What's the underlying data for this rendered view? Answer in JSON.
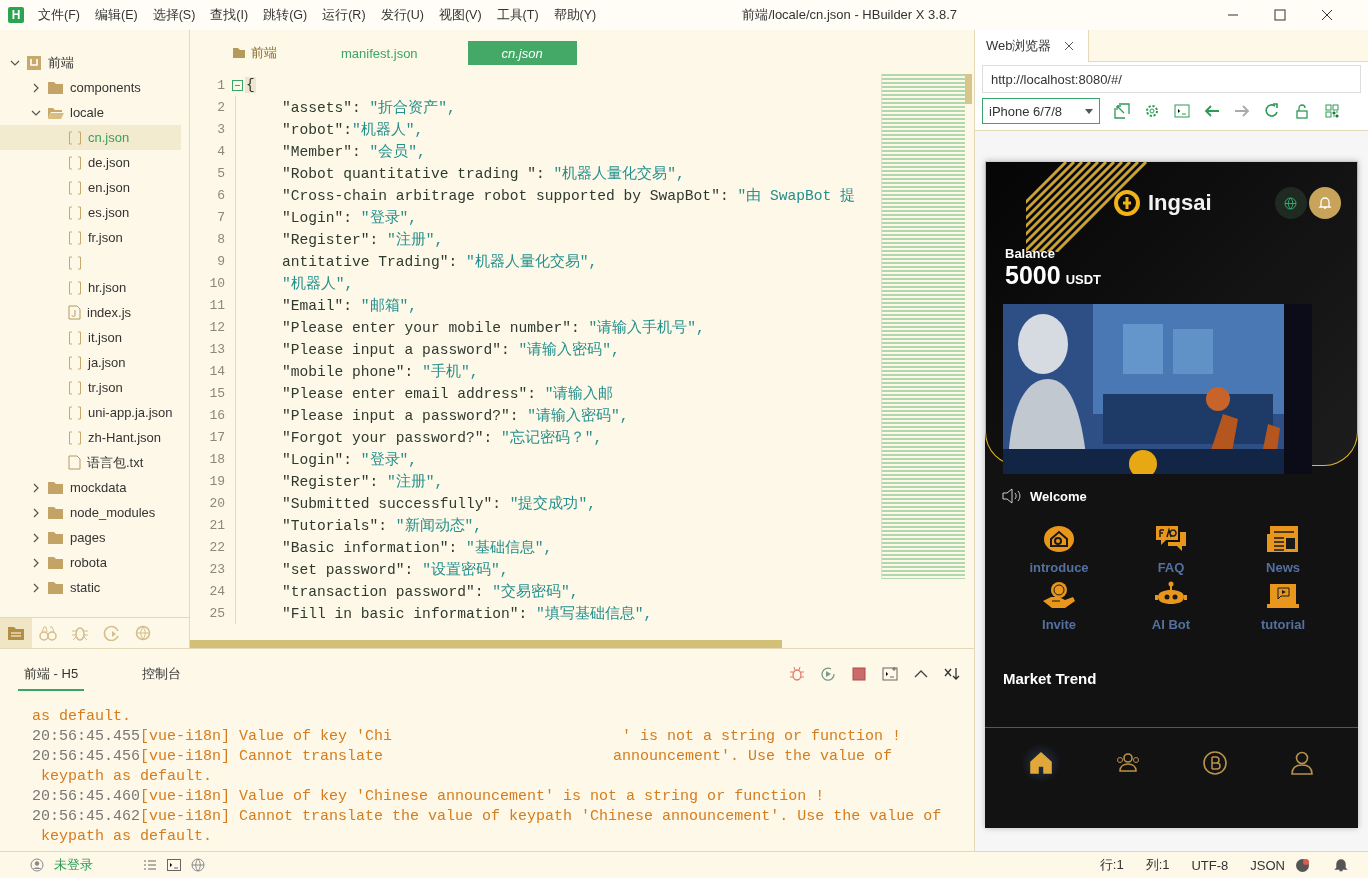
{
  "app_logo": "H",
  "menu": [
    "文件(F)",
    "编辑(E)",
    "选择(S)",
    "查找(I)",
    "跳转(G)",
    "运行(R)",
    "发行(U)",
    "视图(V)",
    "工具(T)",
    "帮助(Y)"
  ],
  "window": {
    "title": "前端/locale/cn.json - HBuilder X 3.8.7"
  },
  "tree": [
    {
      "name": "前端",
      "kind": "project",
      "expanded": true,
      "selected": false,
      "children": [
        {
          "name": "components",
          "kind": "folder",
          "expanded": false,
          "selected": false
        },
        {
          "name": "locale",
          "kind": "folder",
          "expanded": true,
          "selected": false,
          "children": [
            {
              "name": "cn.json",
              "kind": "json",
              "selected": true
            },
            {
              "name": "de.json",
              "kind": "json",
              "selected": false
            },
            {
              "name": "en.json",
              "kind": "json",
              "selected": false
            },
            {
              "name": "es.json",
              "kind": "json",
              "selected": false
            },
            {
              "name": "fr.json",
              "kind": "json",
              "selected": false
            },
            {
              "kind": "obscured",
              "selected": false
            },
            {
              "name": "hr.json",
              "kind": "json",
              "selected": false
            },
            {
              "name": "index.js",
              "kind": "js",
              "selected": false
            },
            {
              "name": "it.json",
              "kind": "json",
              "selected": false
            },
            {
              "name": "ja.json",
              "kind": "json",
              "selected": false
            },
            {
              "name": "tr.json",
              "kind": "json",
              "selected": false
            },
            {
              "name": "uni-app.ja.json",
              "kind": "json",
              "selected": false
            },
            {
              "name": "zh-Hant.json",
              "kind": "json",
              "selected": false
            },
            {
              "name": "语言包.txt",
              "kind": "txt",
              "selected": false
            }
          ]
        },
        {
          "name": "mockdata",
          "kind": "folder",
          "expanded": false,
          "selected": false
        },
        {
          "name": "node_modules",
          "kind": "folder",
          "expanded": false,
          "selected": false
        },
        {
          "name": "pages",
          "kind": "folder",
          "expanded": false,
          "selected": false
        },
        {
          "name": "robota",
          "kind": "folder",
          "expanded": false,
          "selected": false
        },
        {
          "name": "static",
          "kind": "folder",
          "expanded": false,
          "selected": false
        }
      ]
    }
  ],
  "sidebar_tools": [
    {
      "kind": "files",
      "selected": true
    },
    {
      "kind": "binoculars",
      "selected": false
    },
    {
      "kind": "bug",
      "selected": false
    },
    {
      "kind": "run",
      "selected": false
    },
    {
      "kind": "globe",
      "selected": false
    }
  ],
  "editor_tabs": [
    {
      "label": "前端",
      "kind": "project",
      "selected": false
    },
    {
      "label": "manifest.json",
      "kind": "file",
      "selected": false
    },
    {
      "label": "cn.json",
      "kind": "file",
      "selected": true
    }
  ],
  "code": {
    "open_line": "1",
    "open": "{",
    "entries": [
      {
        "n": "2",
        "k": "\"assets\": ",
        "v": "\"折合资产\","
      },
      {
        "n": "3",
        "k": "\"robot\":",
        "v": "\"机器人\","
      },
      {
        "n": "4",
        "k": "\"Member\": ",
        "v": "\"会员\","
      },
      {
        "n": "5",
        "k": "\"Robot quantitative trading \": ",
        "v": "\"机器人量化交易\","
      },
      {
        "n": "6",
        "k": "\"Cross-chain arbitrage robot supported by SwapBot\": ",
        "v": "\"由 SwapBot 提"
      },
      {
        "n": "7",
        "k": "\"Login\": ",
        "v": "\"登录\","
      },
      {
        "n": "8",
        "k": "\"Register\": ",
        "v": "\"注册\","
      },
      {
        "n": "9",
        "k": "antitative Trading\": ",
        "v": "\"机器人量化交易\","
      },
      {
        "n": "10",
        "v": "\"机器人\","
      },
      {
        "n": "11",
        "k": "\"Email\": ",
        "v": "\"邮箱\","
      },
      {
        "n": "12",
        "k": "\"Please enter your mobile number\": ",
        "v": "\"请输入手机号\","
      },
      {
        "n": "13",
        "k": "\"Please input a password\": ",
        "v": "\"请输入密码\","
      },
      {
        "n": "14",
        "k": "\"mobile phone\": ",
        "v": "\"手机\","
      },
      {
        "n": "15",
        "k": "\"Please enter email address\": ",
        "v": "\"请输入邮"
      },
      {
        "n": "16",
        "k": "\"Please input a password?\": ",
        "v": "\"请输入密码\","
      },
      {
        "n": "17",
        "k": "\"Forgot your password?\": ",
        "v": "\"忘记密码？\","
      },
      {
        "n": "18",
        "k": "\"Login\": ",
        "v": "\"登录\","
      },
      {
        "n": "19",
        "k": "\"Register\": ",
        "v": "\"注册\","
      },
      {
        "n": "20",
        "k": "\"Submitted successfully\": ",
        "v": "\"提交成功\","
      },
      {
        "n": "21",
        "k": "\"Tutorials\": ",
        "v": "\"新闻动态\","
      },
      {
        "n": "22",
        "k": "\"Basic information\": ",
        "v": "\"基础信息\","
      },
      {
        "n": "23",
        "k": "\"set password\": ",
        "v": "\"设置密码\","
      },
      {
        "n": "24",
        "k": "\"transaction password\": ",
        "v": "\"交易密码\","
      },
      {
        "n": "25",
        "k": "\"Fill in basic information\": ",
        "v": "\"填写基础信息\","
      }
    ]
  },
  "console": {
    "tabs": [
      {
        "label": "前端 - H5",
        "selected": true
      },
      {
        "label": "控制台",
        "selected": false
      }
    ],
    "tools": [
      {
        "kind": "bug"
      },
      {
        "kind": "replay"
      },
      {
        "kind": "stop"
      },
      {
        "kind": "terminal-plus"
      },
      {
        "kind": "collapse"
      },
      {
        "kind": "clear"
      }
    ],
    "logs": [
      {
        "text": "as default."
      },
      {
        "time": "20:56:45.455",
        "text": "[vue-i18n] Value of key 'Chi",
        "text_after": "' is not a string or function !"
      },
      {
        "time": "20:56:45.456",
        "text": "[vue-i18n] Cannot translate",
        "text_after": "announcement'. Use the value of keypath as default."
      },
      {
        "time": "20:56:45.460",
        "text": "[vue-i18n] Value of key 'Chinese announcement' is not a string or function !"
      },
      {
        "time": "20:56:45.462",
        "text": "[vue-i18n] Cannot translate the value of keypath 'Chinese announcement'. Use the value of keypath as default."
      }
    ]
  },
  "browser": {
    "tab": "Web浏览器",
    "url": "http://localhost:8080/#/",
    "device": "iPhone 6/7/8",
    "tools": [
      {
        "kind": "popout",
        "disabled": false
      },
      {
        "kind": "settings",
        "disabled": false
      },
      {
        "kind": "terminal",
        "disabled": false
      },
      {
        "kind": "back",
        "disabled": false
      },
      {
        "kind": "forward",
        "disabled": true
      },
      {
        "kind": "refresh",
        "disabled": false
      },
      {
        "kind": "lock",
        "disabled": false
      },
      {
        "kind": "qr",
        "disabled": false
      }
    ]
  },
  "phone": {
    "brand": "Ingsai",
    "balance_label": "Balance",
    "balance": "5000",
    "currency": "USDT",
    "notice": "Welcome",
    "features": [
      {
        "label": "introduce",
        "kind": "house"
      },
      {
        "label": "FAQ",
        "kind": "faq"
      },
      {
        "label": "News",
        "kind": "news"
      },
      {
        "label": "Invite",
        "kind": "money"
      },
      {
        "label": "AI Bot",
        "kind": "robot"
      },
      {
        "label": "tutorial",
        "kind": "video"
      }
    ],
    "section": "Market Trend",
    "nav": [
      {
        "kind": "home",
        "selected": true
      },
      {
        "kind": "team",
        "selected": false
      },
      {
        "kind": "coin",
        "selected": false
      },
      {
        "kind": "user",
        "selected": false
      }
    ]
  },
  "status_bar": {
    "user": "未登录",
    "line": "行:1",
    "column": "列:1",
    "encoding": "UTF-8",
    "language": "JSON"
  }
}
